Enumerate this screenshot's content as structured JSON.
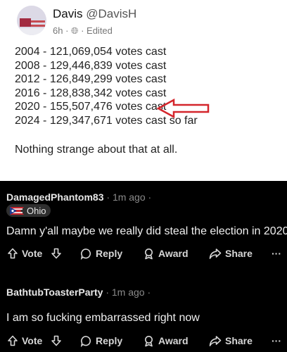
{
  "post": {
    "author": "Davis",
    "handle": "@DavisH",
    "age": "6h",
    "edited": "Edited",
    "lines": [
      "2004 - 121,069,054 votes cast",
      "2008 - 129,446,839 votes cast",
      "2012 - 126,849,299 votes cast",
      "2016 - 128,838,342 votes cast",
      "2020 - 155,507,476 votes cast",
      "2024 - 129,347,671 votes cast so far"
    ],
    "note": "Nothing strange about that at all.",
    "arrow_color": "#d4262c"
  },
  "comments": [
    {
      "user": "DamagedPhantom83",
      "time": "1m ago",
      "flair": "Ohio",
      "text": "Damn y'all maybe we really did steal the election in 2020"
    },
    {
      "user": "BathtubToasterParty",
      "time": "1m ago",
      "text": "I am so fucking embarrassed right now"
    }
  ],
  "actions": {
    "vote": "Vote",
    "reply": "Reply",
    "award": "Award",
    "share": "Share",
    "more": "···"
  }
}
